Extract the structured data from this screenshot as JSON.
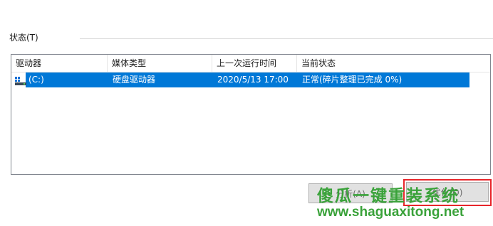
{
  "status_group": {
    "label": "状态(T)"
  },
  "table": {
    "columns": [
      "驱动器",
      "媒体类型",
      "上一次运行时间",
      "当前状态"
    ],
    "rows": [
      {
        "drive": "(C:)",
        "media_type": "硬盘驱动器",
        "last_run": "2020/5/13 17:00",
        "status": "正常(碎片整理已完成 0%)",
        "icon": "drive-icon",
        "selected": true
      }
    ]
  },
  "buttons": {
    "analyze_label": "分析(A)",
    "optimize_label": "优化(O)"
  },
  "watermark": {
    "title": "傻瓜一键重装系统",
    "url": "www.shaguaxitong.net"
  },
  "colors": {
    "selection": "#0078d7",
    "highlight_border": "#e8262b",
    "watermark": "#3aa23a"
  }
}
